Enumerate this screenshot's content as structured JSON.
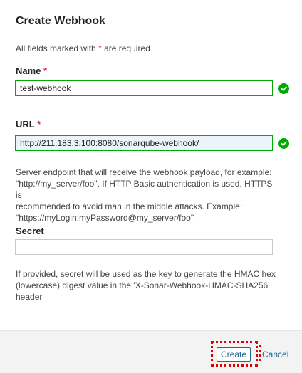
{
  "dialog": {
    "title": "Create Webhook",
    "required_note_prefix": "All fields marked with",
    "required_star": "*",
    "required_note_suffix": "are required"
  },
  "fields": {
    "name": {
      "label": "Name",
      "required_star": "*",
      "value": "test-webhook",
      "status": "valid"
    },
    "url": {
      "label": "URL",
      "required_star": "*",
      "value": "http://211.183.3.100:8080/sonarqube-webhook/",
      "status": "valid",
      "help": [
        "Server endpoint that will receive the webhook payload, for example:",
        "\"http://my_server/foo\". If HTTP Basic authentication is used, HTTPS is",
        "recommended to avoid man in the middle attacks. Example:",
        "\"https://myLogin:myPassword@my_server/foo\""
      ]
    },
    "secret": {
      "label": "Secret",
      "value": "",
      "help": [
        "If provided, secret will be used as the key to generate the HMAC hex",
        "(lowercase) digest value in the 'X-Sonar-Webhook-HMAC-SHA256'",
        "header"
      ]
    }
  },
  "footer": {
    "create_label": "Create",
    "cancel_label": "Cancel"
  },
  "colors": {
    "valid": "#00aa00",
    "required": "#d4333f",
    "link": "#236a97",
    "annotation": "#e00000"
  }
}
